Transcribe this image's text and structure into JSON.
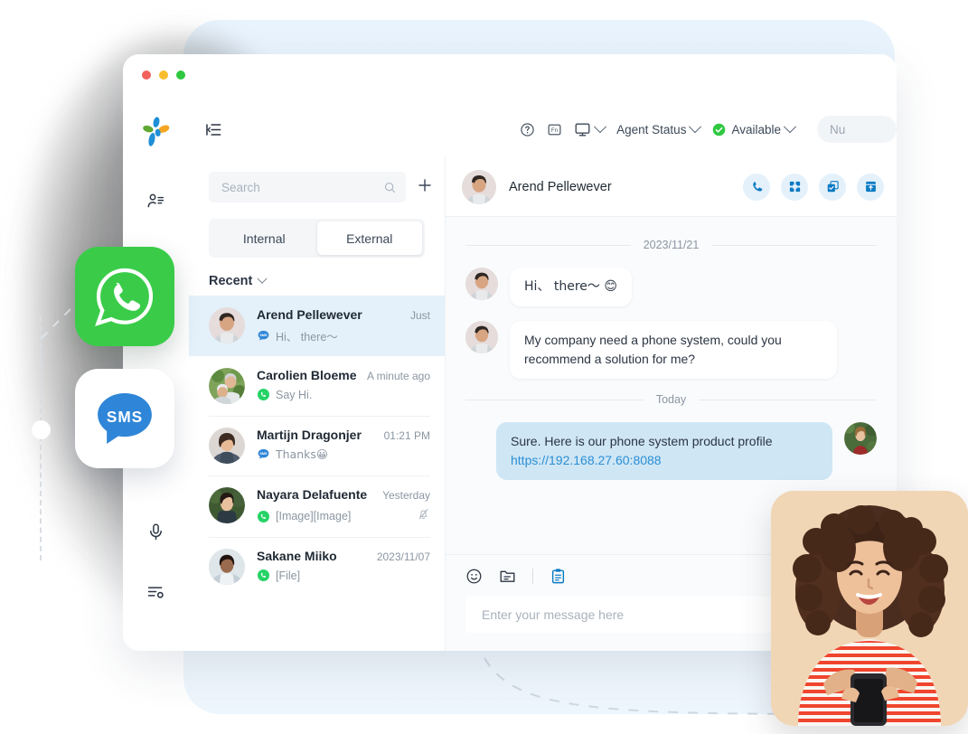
{
  "app": {
    "logo_name": "yeastar-logo",
    "window_controls": [
      "close",
      "minimize",
      "maximize"
    ]
  },
  "sidebar": {
    "items": [
      {
        "name": "contacts",
        "icon": "person-list-icon"
      },
      {
        "name": "address-book",
        "icon": "address-book-icon"
      },
      {
        "name": "voicemail",
        "icon": "microphone-icon"
      },
      {
        "name": "settings",
        "icon": "settings-sliders-icon"
      }
    ]
  },
  "topbar": {
    "menu_icon": "collapse-panel-icon",
    "help_icon": "help-circle-icon",
    "fn_label": "Fn",
    "monitor_icon": "monitor-icon",
    "agent_status_label": "Agent Status",
    "availability_label": "Available",
    "availability_color": "#2fc840",
    "trailing_pill": "Nu"
  },
  "search": {
    "placeholder": "Search",
    "value": "",
    "add_icon": "plus-icon",
    "search_icon": "search-icon"
  },
  "tabs": [
    {
      "label": "Internal",
      "active": false
    },
    {
      "label": "External",
      "active": true
    }
  ],
  "list_header": {
    "label": "Recent",
    "chevron": "chevron-down-icon"
  },
  "conversations": [
    {
      "name": "Arend Pellewever",
      "time": "Just",
      "channel": "sms",
      "preview": "Hi、 there～",
      "selected": true,
      "muted": false
    },
    {
      "name": "Carolien Bloeme",
      "time": "A minute ago",
      "channel": "whatsapp",
      "preview": "Say Hi.",
      "selected": false,
      "muted": false
    },
    {
      "name": "Martijn Dragonjer",
      "time": "01:21 PM",
      "channel": "sms",
      "preview": "Thanks😀",
      "selected": false,
      "muted": false
    },
    {
      "name": "Nayara Delafuente",
      "time": "Yesterday",
      "channel": "whatsapp",
      "preview": "[Image][Image]",
      "selected": false,
      "muted": true
    },
    {
      "name": "Sakane Miiko",
      "time": "2023/11/07",
      "channel": "whatsapp",
      "preview": "[File]",
      "selected": false,
      "muted": false
    }
  ],
  "chat": {
    "title": "Arend Pellewever",
    "actions": [
      {
        "name": "call-button",
        "icon": "phone-icon"
      },
      {
        "name": "transfer-button",
        "icon": "transfer-icon"
      },
      {
        "name": "task-button",
        "icon": "checkbox-stack-icon"
      },
      {
        "name": "archive-button",
        "icon": "archive-upload-icon"
      }
    ],
    "messages": [
      {
        "type": "separator",
        "text": "2023/11/21"
      },
      {
        "type": "in",
        "text": "Hi、 there～ 😊"
      },
      {
        "type": "in",
        "text": "My company need a phone system, could you recommend a solution for me?"
      },
      {
        "type": "separator",
        "text": "Today"
      },
      {
        "type": "out",
        "text": "Sure. Here is our phone system product profile ",
        "link": "https://192.168.27.60:8088"
      }
    ]
  },
  "composer": {
    "tools": [
      {
        "name": "emoji-button",
        "icon": "smiley-icon"
      },
      {
        "name": "attach-file-button",
        "icon": "file-icon"
      },
      {
        "name": "template-button",
        "icon": "clipboard-icon"
      }
    ],
    "placeholder": "Enter your message here",
    "value": ""
  },
  "floating_badges": [
    {
      "name": "whatsapp-badge",
      "label": "WhatsApp",
      "color": "#3ACC49"
    },
    {
      "name": "sms-badge",
      "label": "SMS",
      "color": "#2f86d8"
    }
  ],
  "colors": {
    "accent": "#2a8fd4",
    "selected_row": "#e4f1fb",
    "out_bubble": "#cfe6f5",
    "backdrop": "#eef6fd"
  }
}
